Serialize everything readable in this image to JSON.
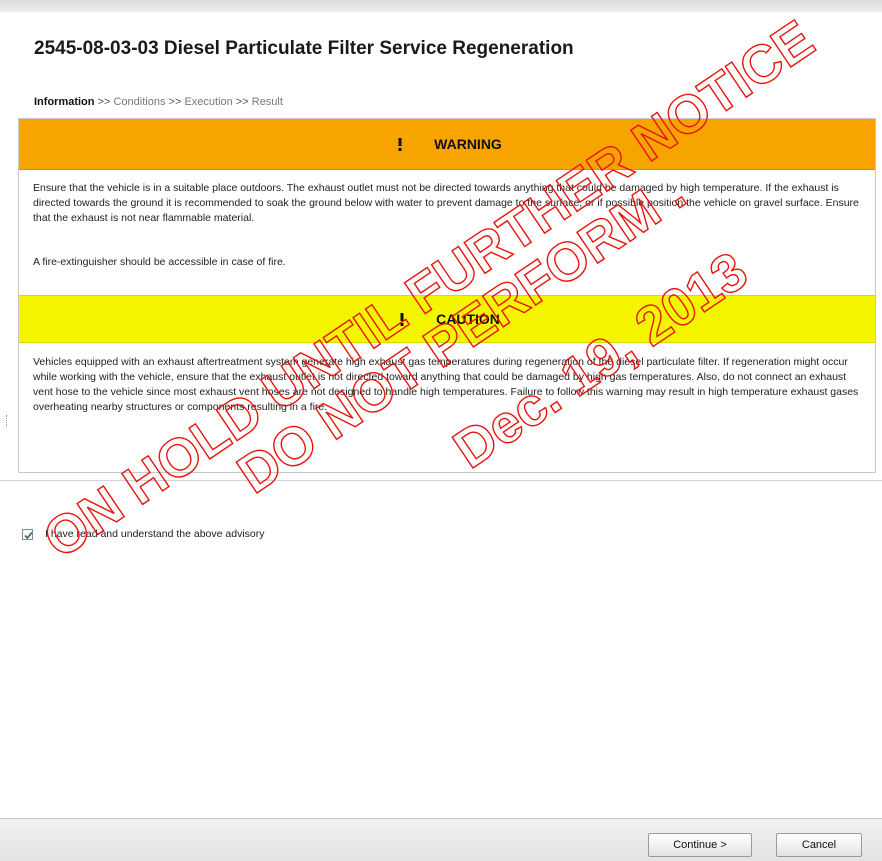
{
  "header": {
    "title": "2545-08-03-03 Diesel Particulate Filter Service Regeneration"
  },
  "breadcrumb": {
    "steps": [
      "Information",
      "Conditions",
      "Execution",
      "Result"
    ],
    "separator": ">>"
  },
  "warning": {
    "heading": "WARNING",
    "color": "#f7a400",
    "icon": "exclamation-icon",
    "paragraph1": "Ensure that the vehicle is in a suitable place outdoors. The exhaust outlet must not be directed towards anything that could be damaged by high temperature. If the exhaust is directed towards the ground it is recommended to soak the ground below with water to prevent damage to the surface, or if possible position the vehicle on gravel surface. Ensure that the exhaust is not near flammable material.",
    "paragraph2": "A fire-extinguisher should be accessible in case of fire."
  },
  "caution": {
    "heading": "CAUTION",
    "color": "#f5f500",
    "icon": "exclamation-icon",
    "paragraph": "Vehicles equipped with an exhaust aftertreatment system generate high exhaust gas temperatures during regeneration of the diesel particulate filter. If regeneration might occur while working with the vehicle, ensure that the exhaust outlet is not directed toward anything that could be damaged by high gas temperatures. Also, do not connect an exhaust vent hose to the vehicle since most exhaust vent hoses are not designed to handle high temperatures. Failure to follow this warning may result in high temperature exhaust gases overheating nearby structures or components resulting in a fire."
  },
  "acknowledge": {
    "label": "I have read and understand the above advisory",
    "checked": true
  },
  "footer": {
    "continue_label": "Continue >",
    "cancel_label": "Cancel"
  },
  "watermark": {
    "line1": "ON HOLD UNTIL FURTHER NOTICE",
    "line2": "DO NOT PERFORM .",
    "line3": "Dec. 19, 2013",
    "color": "#e8140c"
  }
}
